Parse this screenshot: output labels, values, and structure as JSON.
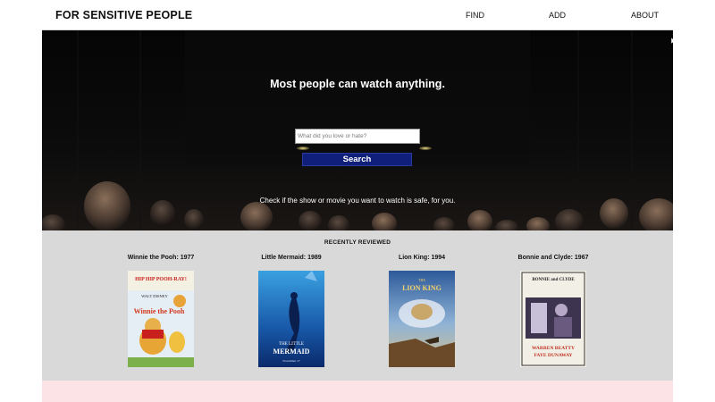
{
  "header": {
    "brand": "FOR SENSITIVE PEOPLE",
    "nav": [
      {
        "label": "FIND"
      },
      {
        "label": "ADD"
      },
      {
        "label": "ABOUT"
      }
    ]
  },
  "hero": {
    "title": "Most people can watch anything.",
    "search": {
      "placeholder": "What did you love or hate?",
      "value": ""
    },
    "search_button": "Search",
    "tagline": "Check if the show or movie you want to watch is safe, for you."
  },
  "recent": {
    "heading": "RECENTLY REVIEWED",
    "movies": [
      {
        "title": "Winnie the Pooh: 1977",
        "poster_icon": "winnie-the-pooh-poster",
        "poster_lines": [
          "HIP HIP POOH-RAY!",
          "WALT DISNEY",
          "Winnie the Pooh"
        ]
      },
      {
        "title": "Little Mermaid: 1989",
        "poster_icon": "little-mermaid-poster",
        "poster_lines": [
          "THE LITTLE",
          "MERMAID",
          "November 17"
        ]
      },
      {
        "title": "Lion King: 1994",
        "poster_icon": "lion-king-poster",
        "poster_lines": [
          "THE",
          "LION KING"
        ]
      },
      {
        "title": "Bonnie and Clyde: 1967",
        "poster_icon": "bonnie-and-clyde-poster",
        "poster_lines": [
          "BONNIE and CLYDE",
          "WARREN BEATTY",
          "FAYE DUNAWAY"
        ]
      }
    ]
  },
  "colors": {
    "hero_bg": "#040404",
    "search_button": "#0f1f7a",
    "recent_bg": "#d9d9d9",
    "page_bg": "#fbe3e6"
  }
}
